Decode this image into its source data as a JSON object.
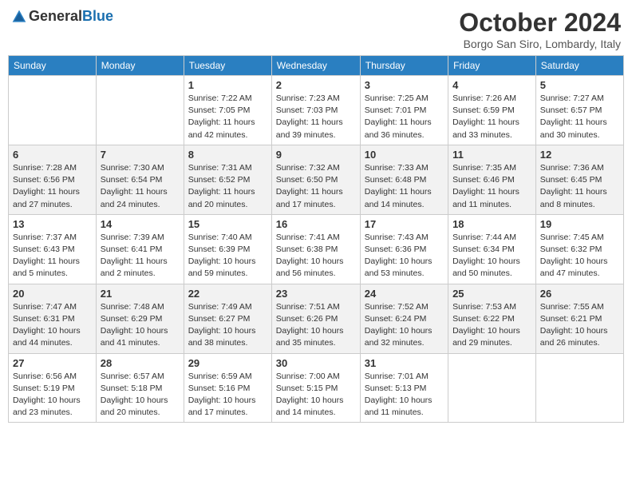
{
  "header": {
    "logo_general": "General",
    "logo_blue": "Blue",
    "month": "October 2024",
    "location": "Borgo San Siro, Lombardy, Italy"
  },
  "columns": [
    "Sunday",
    "Monday",
    "Tuesday",
    "Wednesday",
    "Thursday",
    "Friday",
    "Saturday"
  ],
  "weeks": [
    [
      {
        "day": "",
        "info": ""
      },
      {
        "day": "",
        "info": ""
      },
      {
        "day": "1",
        "info": "Sunrise: 7:22 AM\nSunset: 7:05 PM\nDaylight: 11 hours and 42 minutes."
      },
      {
        "day": "2",
        "info": "Sunrise: 7:23 AM\nSunset: 7:03 PM\nDaylight: 11 hours and 39 minutes."
      },
      {
        "day": "3",
        "info": "Sunrise: 7:25 AM\nSunset: 7:01 PM\nDaylight: 11 hours and 36 minutes."
      },
      {
        "day": "4",
        "info": "Sunrise: 7:26 AM\nSunset: 6:59 PM\nDaylight: 11 hours and 33 minutes."
      },
      {
        "day": "5",
        "info": "Sunrise: 7:27 AM\nSunset: 6:57 PM\nDaylight: 11 hours and 30 minutes."
      }
    ],
    [
      {
        "day": "6",
        "info": "Sunrise: 7:28 AM\nSunset: 6:56 PM\nDaylight: 11 hours and 27 minutes."
      },
      {
        "day": "7",
        "info": "Sunrise: 7:30 AM\nSunset: 6:54 PM\nDaylight: 11 hours and 24 minutes."
      },
      {
        "day": "8",
        "info": "Sunrise: 7:31 AM\nSunset: 6:52 PM\nDaylight: 11 hours and 20 minutes."
      },
      {
        "day": "9",
        "info": "Sunrise: 7:32 AM\nSunset: 6:50 PM\nDaylight: 11 hours and 17 minutes."
      },
      {
        "day": "10",
        "info": "Sunrise: 7:33 AM\nSunset: 6:48 PM\nDaylight: 11 hours and 14 minutes."
      },
      {
        "day": "11",
        "info": "Sunrise: 7:35 AM\nSunset: 6:46 PM\nDaylight: 11 hours and 11 minutes."
      },
      {
        "day": "12",
        "info": "Sunrise: 7:36 AM\nSunset: 6:45 PM\nDaylight: 11 hours and 8 minutes."
      }
    ],
    [
      {
        "day": "13",
        "info": "Sunrise: 7:37 AM\nSunset: 6:43 PM\nDaylight: 11 hours and 5 minutes."
      },
      {
        "day": "14",
        "info": "Sunrise: 7:39 AM\nSunset: 6:41 PM\nDaylight: 11 hours and 2 minutes."
      },
      {
        "day": "15",
        "info": "Sunrise: 7:40 AM\nSunset: 6:39 PM\nDaylight: 10 hours and 59 minutes."
      },
      {
        "day": "16",
        "info": "Sunrise: 7:41 AM\nSunset: 6:38 PM\nDaylight: 10 hours and 56 minutes."
      },
      {
        "day": "17",
        "info": "Sunrise: 7:43 AM\nSunset: 6:36 PM\nDaylight: 10 hours and 53 minutes."
      },
      {
        "day": "18",
        "info": "Sunrise: 7:44 AM\nSunset: 6:34 PM\nDaylight: 10 hours and 50 minutes."
      },
      {
        "day": "19",
        "info": "Sunrise: 7:45 AM\nSunset: 6:32 PM\nDaylight: 10 hours and 47 minutes."
      }
    ],
    [
      {
        "day": "20",
        "info": "Sunrise: 7:47 AM\nSunset: 6:31 PM\nDaylight: 10 hours and 44 minutes."
      },
      {
        "day": "21",
        "info": "Sunrise: 7:48 AM\nSunset: 6:29 PM\nDaylight: 10 hours and 41 minutes."
      },
      {
        "day": "22",
        "info": "Sunrise: 7:49 AM\nSunset: 6:27 PM\nDaylight: 10 hours and 38 minutes."
      },
      {
        "day": "23",
        "info": "Sunrise: 7:51 AM\nSunset: 6:26 PM\nDaylight: 10 hours and 35 minutes."
      },
      {
        "day": "24",
        "info": "Sunrise: 7:52 AM\nSunset: 6:24 PM\nDaylight: 10 hours and 32 minutes."
      },
      {
        "day": "25",
        "info": "Sunrise: 7:53 AM\nSunset: 6:22 PM\nDaylight: 10 hours and 29 minutes."
      },
      {
        "day": "26",
        "info": "Sunrise: 7:55 AM\nSunset: 6:21 PM\nDaylight: 10 hours and 26 minutes."
      }
    ],
    [
      {
        "day": "27",
        "info": "Sunrise: 6:56 AM\nSunset: 5:19 PM\nDaylight: 10 hours and 23 minutes."
      },
      {
        "day": "28",
        "info": "Sunrise: 6:57 AM\nSunset: 5:18 PM\nDaylight: 10 hours and 20 minutes."
      },
      {
        "day": "29",
        "info": "Sunrise: 6:59 AM\nSunset: 5:16 PM\nDaylight: 10 hours and 17 minutes."
      },
      {
        "day": "30",
        "info": "Sunrise: 7:00 AM\nSunset: 5:15 PM\nDaylight: 10 hours and 14 minutes."
      },
      {
        "day": "31",
        "info": "Sunrise: 7:01 AM\nSunset: 5:13 PM\nDaylight: 10 hours and 11 minutes."
      },
      {
        "day": "",
        "info": ""
      },
      {
        "day": "",
        "info": ""
      }
    ]
  ]
}
